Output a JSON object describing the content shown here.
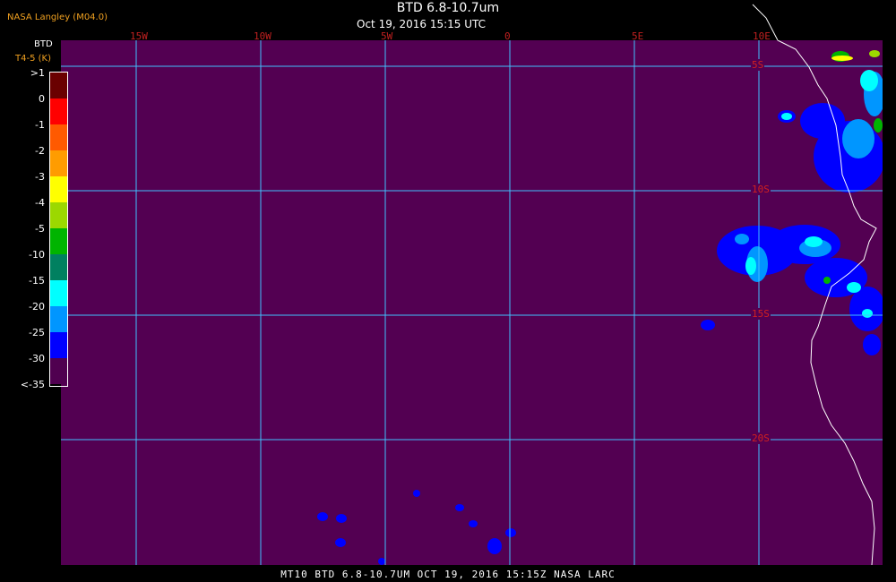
{
  "header": {
    "producer": "NASA Langley (M04.0)",
    "title": "BTD 6.8-10.7um",
    "datetime": "Oct 19, 2016 15:15 UTC"
  },
  "colorbar": {
    "title": "BTD",
    "subtitle": "T4-5 (K)",
    "ticks": [
      ">1",
      "0",
      "-1",
      "-2",
      "-3",
      "-4",
      "-5",
      "-10",
      "-15",
      "-20",
      "-25",
      "-30",
      "<-35"
    ],
    "colors": [
      "#6a0000",
      "#ff0000",
      "#ff5a00",
      "#ff9c00",
      "#ffff00",
      "#9cd800",
      "#00b400",
      "#008060",
      "#00ffff",
      "#0096ff",
      "#0000ff",
      "#500050"
    ]
  },
  "map": {
    "background_color": "#530052",
    "grid_color": "#40c0ff",
    "lon_labels": [
      "15W",
      "10W",
      "5W",
      "0",
      "5E",
      "10E"
    ],
    "lat_labels": [
      "5S",
      "10S",
      "15S",
      "20S"
    ]
  },
  "footer": "MT10  BTD 6.8-10.7UM   OCT 19, 2016 15:15Z   NASA LARC"
}
